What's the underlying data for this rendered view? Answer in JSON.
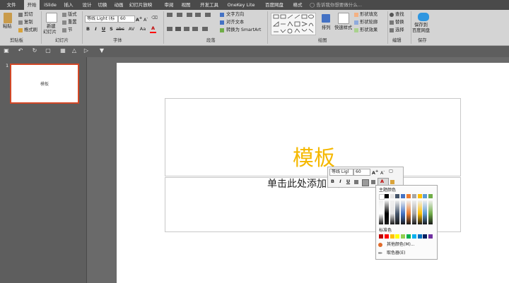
{
  "tabs": [
    "文件",
    "开始",
    "iSlide",
    "插入",
    "设计",
    "切换",
    "动画",
    "幻灯片放映",
    "审阅",
    "视图",
    "开发工具",
    "OneKey Lite",
    "百度网盘",
    "格式"
  ],
  "active_tab": "开始",
  "tell_me": "告诉我你想要做什么...",
  "ribbon": {
    "clipboard": {
      "paste": "粘贴",
      "cut": "剪切",
      "copy": "复制",
      "format_painter": "格式刷",
      "label": "剪贴板"
    },
    "slides": {
      "new_slide": "新建",
      "new_slide2": "幻灯片",
      "layout": "版式",
      "reset": "重置",
      "section": "节",
      "label": "幻灯片"
    },
    "font": {
      "name": "等线 Light (标",
      "size": "60",
      "bold": "B",
      "italic": "I",
      "underline": "U",
      "strike": "S",
      "shadow": "abc",
      "spacing": "AV",
      "case": "Aa",
      "color": "A",
      "label": "字体"
    },
    "paragraph": {
      "text_direction": "文字方向",
      "align_text": "对齐文本",
      "smartart": "转换为 SmartArt",
      "label": "段落"
    },
    "drawing": {
      "arrange": "排列",
      "quick_styles": "快速样式",
      "fill": "形状填充",
      "outline": "形状轮廓",
      "effects": "形状效果",
      "label": "绘图"
    },
    "editing": {
      "find": "查找",
      "replace": "替换",
      "select": "选择",
      "label": "编辑"
    },
    "save": {
      "line1": "保存到",
      "line2": "百度网盘",
      "label": "保存"
    }
  },
  "thumbnail": {
    "number": "1",
    "text": "模板"
  },
  "slide": {
    "title": "模板",
    "subtitle": "单击此处添加副标题"
  },
  "mini_toolbar": {
    "font": "等线 Ligl",
    "size": "60",
    "bold": "B",
    "italic": "I",
    "underline": "U"
  },
  "color_menu": {
    "theme_label": "主题颜色",
    "standard_label": "标准色",
    "more_colors": "其他颜色(M)...",
    "eyedropper": "取色器(E)",
    "theme_colors": [
      "#ffffff",
      "#000000",
      "#e7e6e6",
      "#44546a",
      "#4472c4",
      "#ed7d31",
      "#a5a5a5",
      "#ffc000",
      "#5b9bd5",
      "#70ad47"
    ],
    "standard_colors": [
      "#c00000",
      "#ff0000",
      "#ffc000",
      "#ffff00",
      "#92d050",
      "#00b050",
      "#00b0f0",
      "#0070c0",
      "#002060",
      "#7030a0"
    ]
  },
  "colors": {
    "title_color": "#f5b800",
    "accent": "#d24726"
  }
}
